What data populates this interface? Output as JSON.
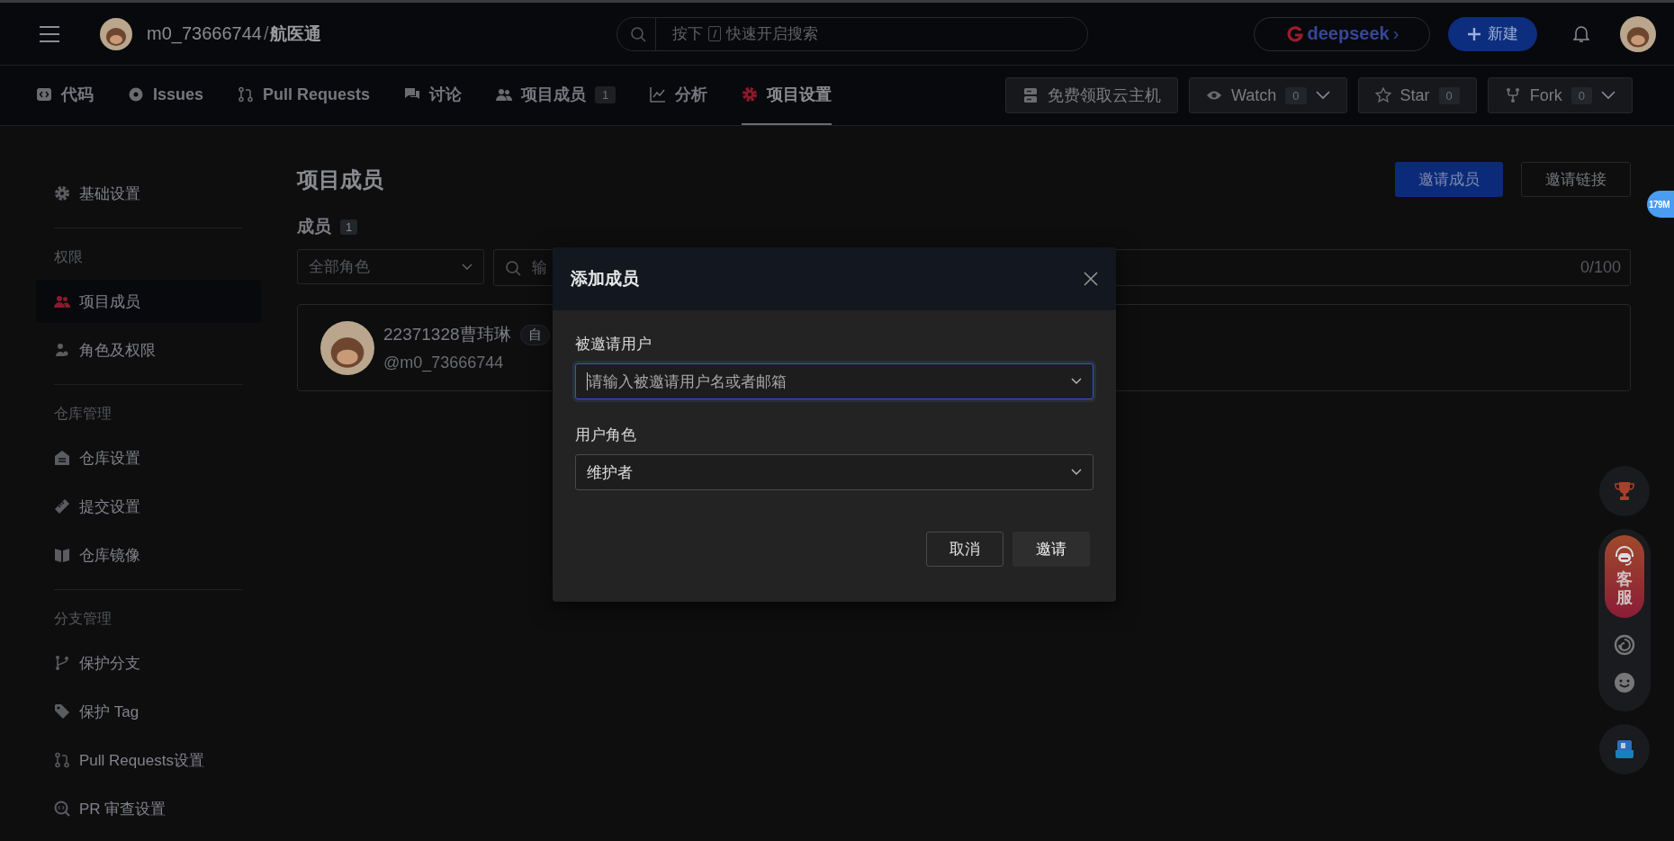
{
  "top_bar": {
    "owner": "m0_73666744",
    "separator": "/",
    "repo": "航医通",
    "search": {
      "prefix": "按下",
      "key": "/",
      "suffix": "快速开启搜索"
    },
    "deepseek": {
      "label": "deepseek",
      "chevron": "›"
    },
    "new_button": "新建"
  },
  "tabs": [
    {
      "label": "代码",
      "selected": false
    },
    {
      "label": "Issues",
      "selected": false
    },
    {
      "label": "Pull Requests",
      "selected": false
    },
    {
      "label": "讨论",
      "selected": false
    },
    {
      "label": "项目成员",
      "count": "1",
      "selected": false
    },
    {
      "label": "分析",
      "selected": false
    },
    {
      "label": "项目设置",
      "selected": true
    }
  ],
  "repo_actions": [
    {
      "label": "免费领取云主机",
      "dropdown": false
    },
    {
      "label": "Watch",
      "count": "0",
      "dropdown": true
    },
    {
      "label": "Star",
      "count": "0",
      "dropdown": false
    },
    {
      "label": "Fork",
      "count": "0",
      "dropdown": true
    }
  ],
  "sidebar": [
    {
      "items": [
        {
          "label": "基础设置",
          "selected": false
        }
      ]
    },
    {
      "heading": "权限",
      "items": [
        {
          "label": "项目成员",
          "selected": true
        },
        {
          "label": "角色及权限",
          "selected": false
        }
      ]
    },
    {
      "heading": "仓库管理",
      "items": [
        {
          "label": "仓库设置",
          "selected": false
        },
        {
          "label": "提交设置",
          "selected": false
        },
        {
          "label": "仓库镜像",
          "selected": false
        }
      ]
    },
    {
      "heading": "分支管理",
      "items": [
        {
          "label": "保护分支",
          "selected": false
        },
        {
          "label": "保护 Tag",
          "selected": false
        },
        {
          "label": "Pull Requests设置",
          "selected": false
        },
        {
          "label": "PR 审查设置",
          "selected": false
        }
      ]
    }
  ],
  "main": {
    "title": "项目成员",
    "invite_button": "邀请成员",
    "link_button": "邀请链接",
    "members_heading": "成员",
    "members_count": "1",
    "role_filter": "全部角色",
    "search_placeholder": "输",
    "char_count": "0/100",
    "members": [
      {
        "name": "22371328曹玮琳",
        "badge": "自",
        "handle": "@m0_73666744"
      }
    ]
  },
  "floating": {
    "memory_badge": "179M",
    "service_label": "客服"
  },
  "dialog": {
    "title": "添加成员",
    "user_label": "被邀请用户",
    "user_placeholder": "请输入被邀请用户名或者邮箱",
    "user_focused": true,
    "role_label": "用户角色",
    "role_value": "维护者",
    "cancel": "取消",
    "confirm": "邀请"
  }
}
